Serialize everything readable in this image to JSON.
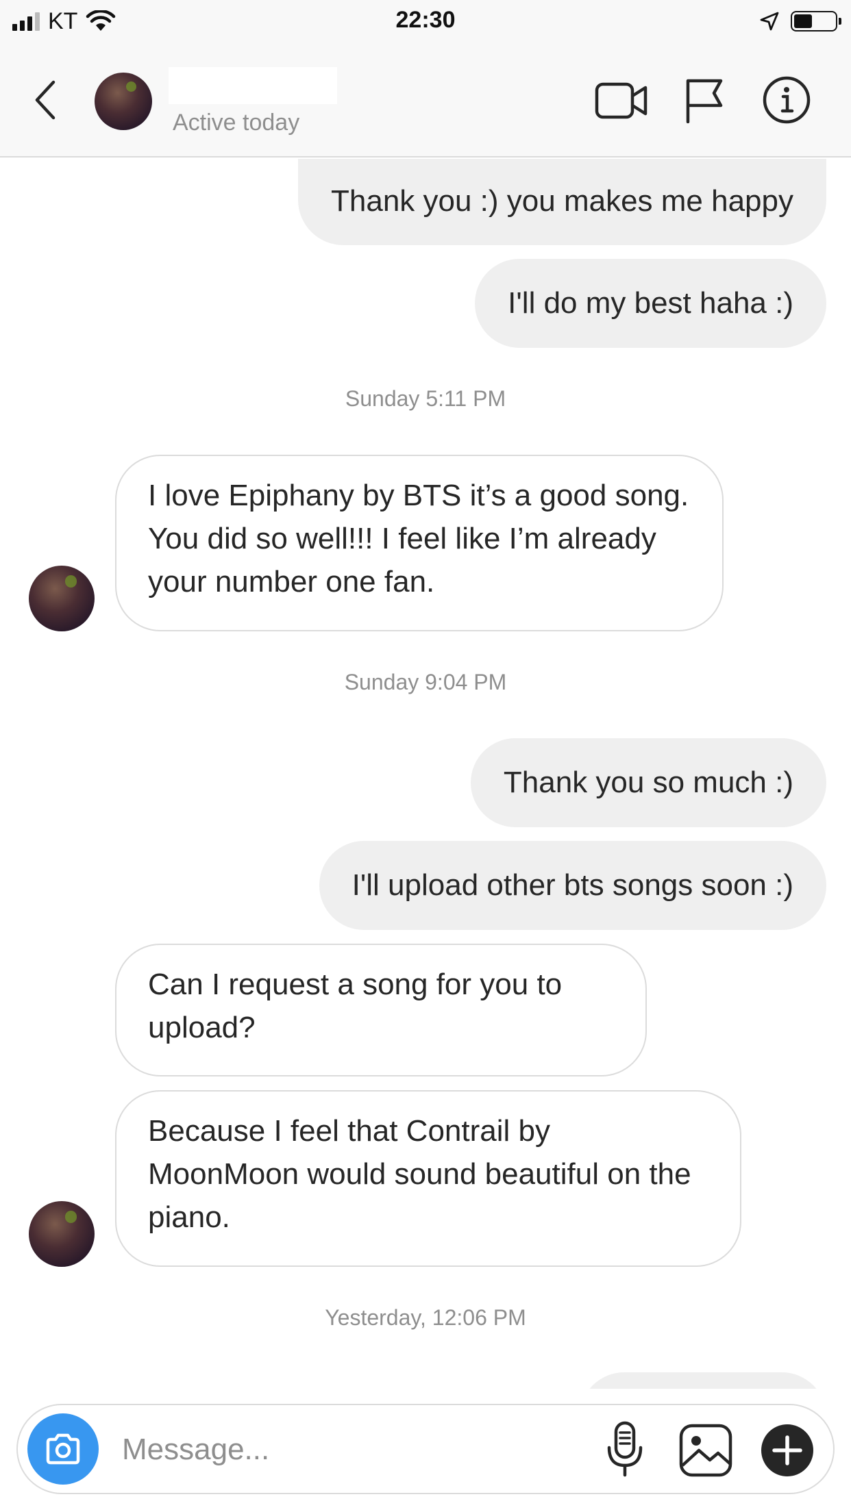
{
  "status_bar": {
    "carrier": "KT",
    "time": "22:30"
  },
  "header": {
    "back_icon": "chevron-left-icon",
    "active_status": "Active today",
    "icons": [
      "video-call-icon",
      "flag-icon",
      "info-icon"
    ]
  },
  "messages": [
    {
      "type": "outgoing",
      "text": "Thank you :) you makes me happy"
    },
    {
      "type": "outgoing",
      "text": "I'll do my best haha :)"
    },
    {
      "type": "timestamp",
      "text": "Sunday 5:11 PM"
    },
    {
      "type": "incoming",
      "text": "I love Epiphany by BTS it’s a good song. You did so well!!! I feel like I’m already your number one fan."
    },
    {
      "type": "timestamp",
      "text": "Sunday 9:04 PM"
    },
    {
      "type": "outgoing",
      "text": "Thank you so much :)"
    },
    {
      "type": "outgoing",
      "text": "I'll upload other bts songs soon :)"
    },
    {
      "type": "incoming",
      "text": "Can I request a song for you to upload?"
    },
    {
      "type": "incoming",
      "text": "Because I feel that Contrail by MoonMoon would sound beautiful on the piano."
    },
    {
      "type": "timestamp",
      "text": "Yesterday, 12:06 PM"
    }
  ],
  "composer": {
    "placeholder": "Message...",
    "icons": [
      "camera-icon",
      "microphone-icon",
      "gallery-icon",
      "plus-icon"
    ]
  },
  "colors": {
    "accent": "#3897f0",
    "outgoing_bubble": "#efefef",
    "incoming_border": "#dbdbdb",
    "secondary_text": "#8e8e8e"
  }
}
